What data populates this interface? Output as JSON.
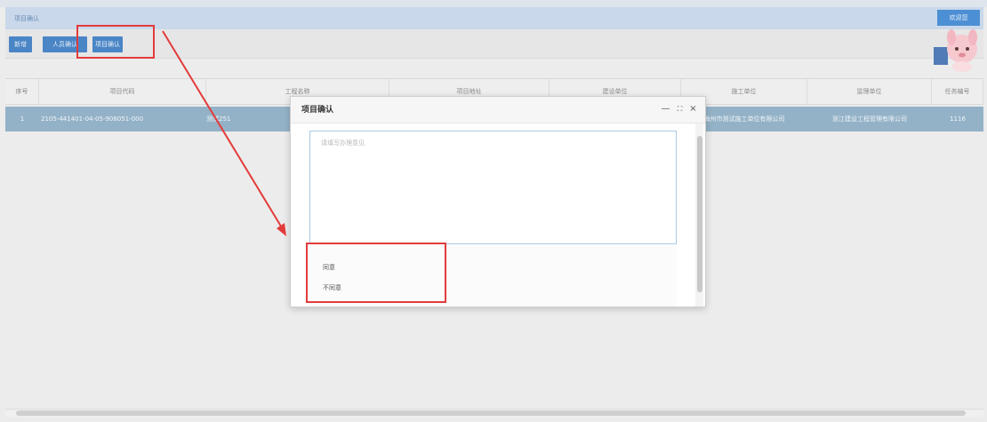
{
  "tab": {
    "label": "项目确认"
  },
  "user_menu": {
    "label": "欢迎您"
  },
  "toolbar": {
    "buttons": [
      "新增",
      "人员确认",
      "项目确认"
    ]
  },
  "grid": {
    "headers": [
      "序号",
      "项目代码",
      "工程名称",
      "项目地址",
      "建设单位",
      "施工单位",
      "监理单位",
      "任务编号"
    ],
    "rows": [
      {
        "index": "1",
        "code": "2105-441401-04-05-908051-000",
        "name": "测试251",
        "address": "",
        "owner": "",
        "contractor": "梅州市测试施工单位有限公司",
        "supervisor": "浙江建设工程管理有限公司",
        "task_no": "1116"
      }
    ]
  },
  "dialog": {
    "title": "项目确认",
    "placeholder": "请填写办理意见",
    "options": [
      "同意",
      "不同意"
    ],
    "controls": {
      "minimize": "—",
      "maximize": "⛶",
      "close": "×"
    }
  },
  "colors": {
    "accent": "#4a85c6",
    "highlight": "#e33b3b",
    "selected_row": "#94b2c7"
  }
}
